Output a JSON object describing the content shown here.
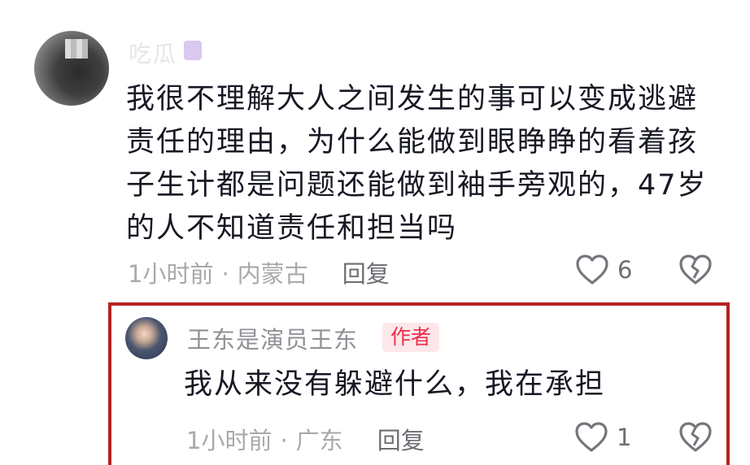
{
  "main_comment": {
    "username": "吃瓜",
    "text": "我很不理解大人之间发生的事可以变成逃避责任的理由，为什么能做到眼睁睁的看着孩子生计都是问题还能做到袖手旁观的，47岁的人不知道责任和担当吗",
    "time": "1小时前",
    "separator": "·",
    "location": "内蒙古",
    "reply_label": "回复",
    "like_count": "6"
  },
  "reply_comment": {
    "username": "王东是演员王东",
    "author_tag": "作者",
    "text": "我从来没有躲避什么，我在承担",
    "time": "1小时前",
    "separator": "·",
    "location": "广东",
    "reply_label": "回复",
    "like_count": "1"
  },
  "colors": {
    "highlight_border": "#b32320",
    "author_tag_bg": "#fde7ea",
    "author_tag_text": "#ec2d4a"
  },
  "icons": [
    "heart-icon",
    "broken-heart-icon"
  ]
}
